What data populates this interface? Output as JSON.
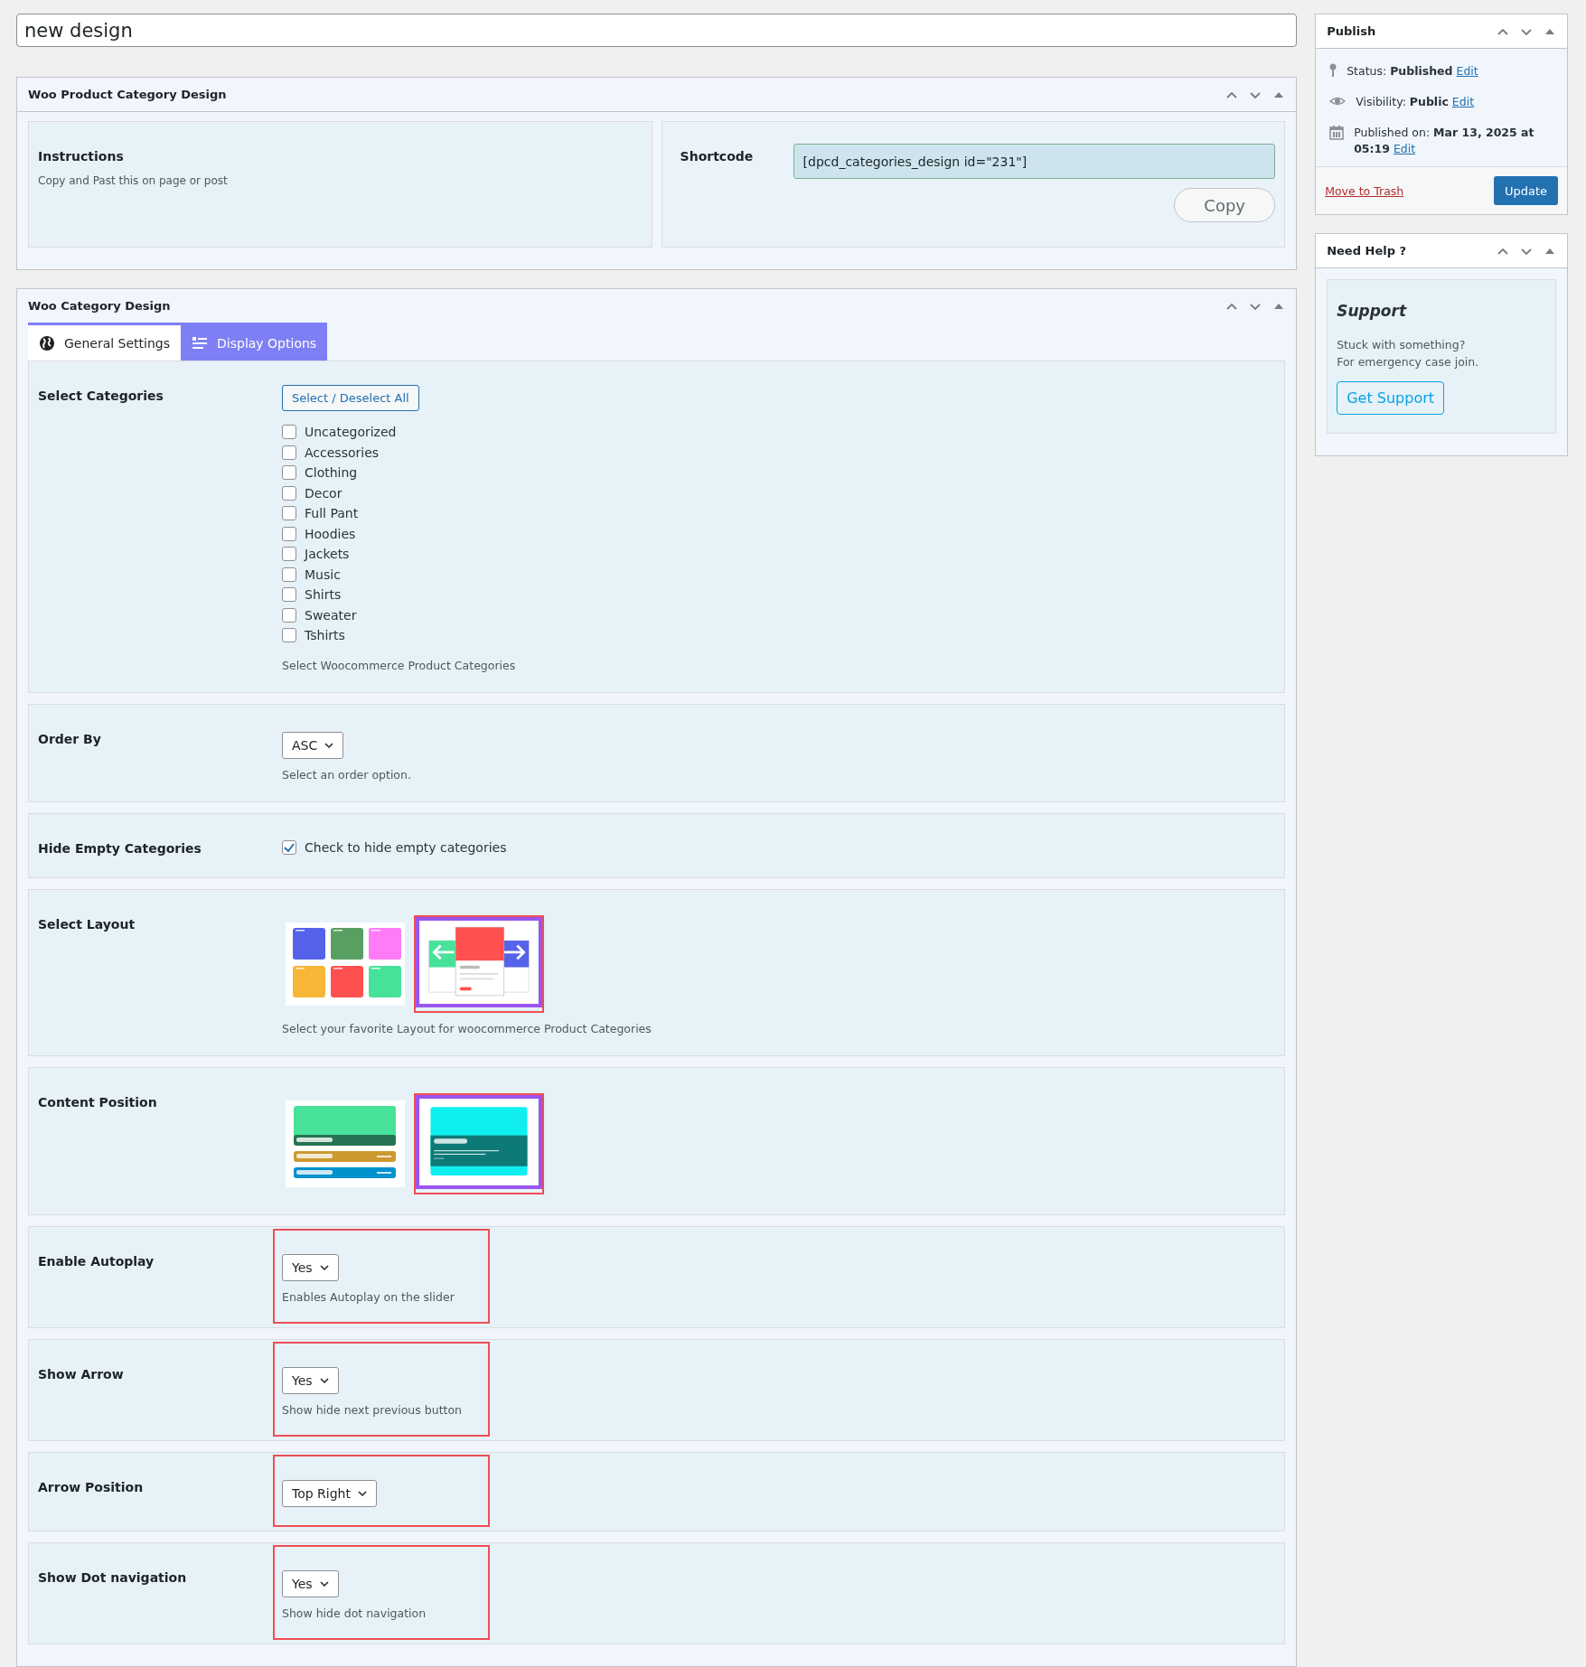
{
  "title_field": {
    "value": "new design"
  },
  "shortcode_box": {
    "title": "Woo Product Category Design",
    "instructions": {
      "heading": "Instructions",
      "text": "Copy and Past this on page or post"
    },
    "shortcode": {
      "label": "Shortcode",
      "value": "[dpcd_categories_design id=\"231\"]",
      "button": "Copy"
    }
  },
  "design_box": {
    "title": "Woo Category Design",
    "tabs": [
      {
        "label": "General Settings",
        "selected": false
      },
      {
        "label": "Display Options",
        "selected": true
      }
    ],
    "rows": [
      {
        "kind": "checklist",
        "label": "Select Categories",
        "button": "Select / Deselect All",
        "options": [
          {
            "label": "Uncategorized",
            "checked": false
          },
          {
            "label": "Accessories",
            "checked": false
          },
          {
            "label": "Clothing",
            "checked": false
          },
          {
            "label": "Decor",
            "checked": false
          },
          {
            "label": "Full Pant",
            "checked": false
          },
          {
            "label": "Hoodies",
            "checked": false
          },
          {
            "label": "Jackets",
            "checked": false
          },
          {
            "label": "Music",
            "checked": false
          },
          {
            "label": "Shirts",
            "checked": false
          },
          {
            "label": "Sweater",
            "checked": false
          },
          {
            "label": "Tshirts",
            "checked": false
          }
        ],
        "help": "Select Woocommerce Product Categories",
        "highlighted": false
      },
      {
        "kind": "select",
        "label": "Order By",
        "value": "ASC",
        "help": "Select an order option.",
        "highlighted": false
      },
      {
        "kind": "checkbox",
        "label": "Hide Empty Categories",
        "text": "Check to hide empty categories",
        "checked": true,
        "highlighted": false
      },
      {
        "kind": "image_choice",
        "label": "Select Layout",
        "options": [
          {
            "kind": "grid",
            "selected": false,
            "highlighted": false
          },
          {
            "kind": "slider",
            "selected": true,
            "highlighted": true
          }
        ],
        "help": "Select your favorite Layout for woocommerce Product Categories",
        "highlighted": false
      },
      {
        "kind": "image_choice",
        "label": "Content Position",
        "options": [
          {
            "kind": "stacked",
            "selected": false,
            "highlighted": false
          },
          {
            "kind": "overlay",
            "selected": true,
            "highlighted": true
          }
        ],
        "highlighted": false
      },
      {
        "kind": "select",
        "label": "Enable Autoplay",
        "value": "Yes",
        "help": "Enables Autoplay on the slider",
        "highlighted": true
      },
      {
        "kind": "select",
        "label": "Show Arrow",
        "value": "Yes",
        "help": "Show hide next previous button",
        "highlighted": true
      },
      {
        "kind": "select",
        "label": "Arrow Position",
        "value": "Top Right",
        "highlighted": true
      },
      {
        "kind": "select",
        "label": "Show Dot navigation",
        "value": "Yes",
        "help": "Show hide dot navigation",
        "highlighted": true
      }
    ]
  },
  "publish_box": {
    "title": "Publish",
    "meta": [
      {
        "text": "Status: **Published**",
        "link": "Edit"
      },
      {
        "text": "Visibility: **Public**",
        "link": "Edit"
      },
      {
        "text": "Published on: **Mar 13, 2025 at 05:19**",
        "link": "Edit"
      }
    ],
    "trash_link": "Move to Trash",
    "update_button": "Update"
  },
  "help_box": {
    "title": "Need Help ?",
    "heading": "Support",
    "lines": [
      "Stuck with something?",
      "For emergency case join."
    ],
    "button": "Get Support"
  }
}
